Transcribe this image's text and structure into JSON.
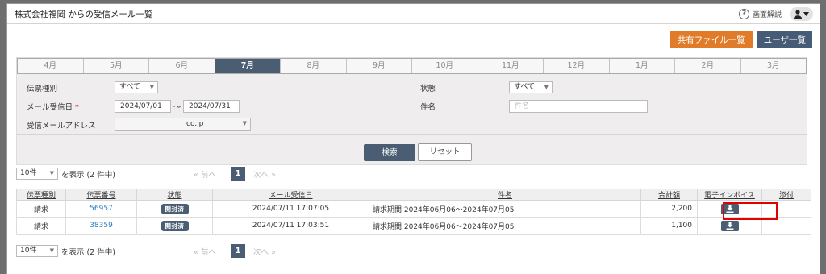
{
  "window": {
    "title": "株式会社福岡 からの受信メール一覧"
  },
  "help": {
    "label": "画面解説"
  },
  "buttons": {
    "shared_files": "共有ファイル一覧",
    "user_list": "ユーザ一覧",
    "search": "検索",
    "reset": "リセット"
  },
  "months": [
    {
      "label": "4月",
      "active": false
    },
    {
      "label": "5月",
      "active": false
    },
    {
      "label": "6月",
      "active": false
    },
    {
      "label": "7月",
      "active": true
    },
    {
      "label": "8月",
      "active": false
    },
    {
      "label": "9月",
      "active": false
    },
    {
      "label": "10月",
      "active": false
    },
    {
      "label": "11月",
      "active": false
    },
    {
      "label": "12月",
      "active": false
    },
    {
      "label": "1月",
      "active": false
    },
    {
      "label": "2月",
      "active": false
    },
    {
      "label": "3月",
      "active": false
    }
  ],
  "filters": {
    "slip_type_label": "伝票種別",
    "slip_type_value": "すべて",
    "status_label": "状態",
    "status_value": "すべて",
    "received_label": "メール受信日",
    "required_mark": "*",
    "date_from": "2024/07/01",
    "date_sep": "～",
    "date_to": "2024/07/31",
    "subject_label": "件名",
    "subject_placeholder": "件名",
    "address_label": "受信メールアドレス",
    "address_value": "co.jp"
  },
  "pager": {
    "per_page": "10件",
    "count_text": "を表示 (2 件中)",
    "prev": "« 前へ",
    "page": "1",
    "next": "次へ »"
  },
  "table": {
    "headers": [
      "伝票種別",
      "伝票番号",
      "状態",
      "メール受信日",
      "件名",
      "合計額",
      "電子インボイス",
      "添付"
    ],
    "rows": [
      {
        "type": "請求",
        "number": "56957",
        "status": "開封済",
        "received": "2024/07/11 17:07:05",
        "subject": "請求期間 2024年06月06～2024年07月05",
        "total": "2,200"
      },
      {
        "type": "請求",
        "number": "38359",
        "status": "開封済",
        "received": "2024/07/11 17:03:51",
        "subject": "請求期間 2024年06月06～2024年07月05",
        "total": "1,100"
      }
    ]
  },
  "colors": {
    "accent_navy": "#4a5d73",
    "accent_orange": "#e07b29",
    "highlight": "#e20000",
    "link": "#2a7bc0"
  }
}
